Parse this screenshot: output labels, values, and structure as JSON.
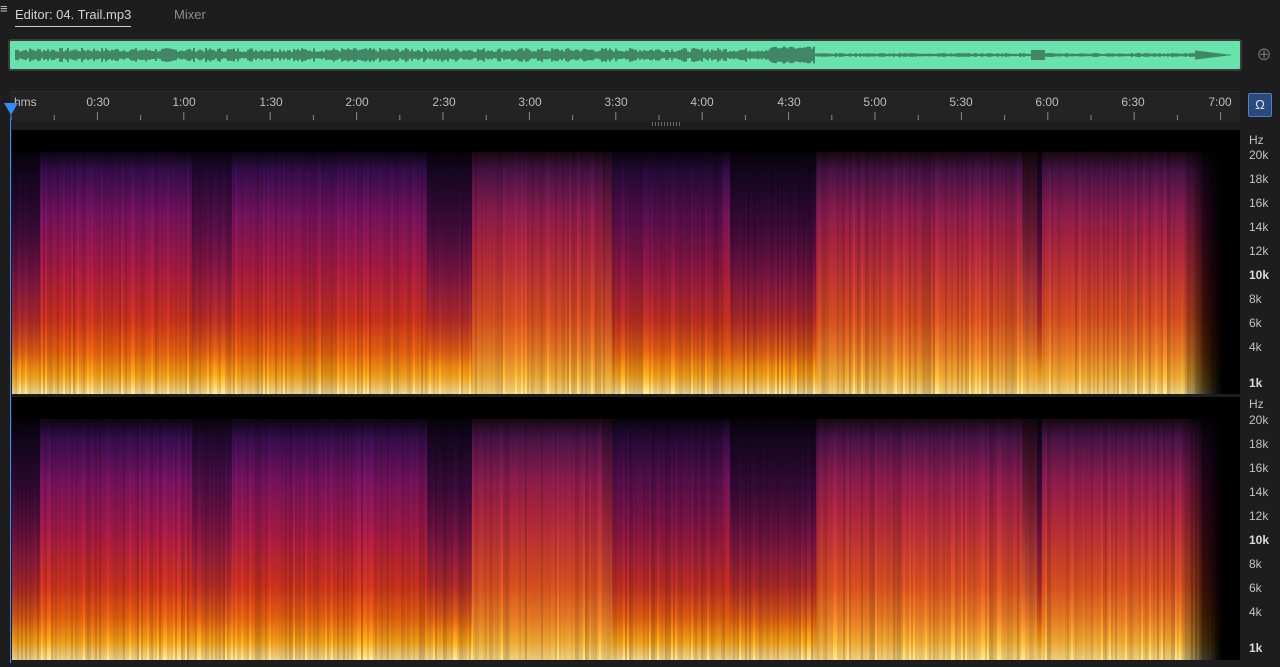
{
  "tabs": {
    "editor_label": "Editor: 04. Trail.mp3",
    "menu_icon": "≡",
    "mixer_label": "Mixer"
  },
  "overview": {
    "waveform_color": "#67e3ab",
    "zoom_icon": "zoom-navigator-icon"
  },
  "ruler": {
    "unit_label": "hms",
    "labels": [
      "0:30",
      "1:00",
      "1:30",
      "2:00",
      "2:30",
      "3:00",
      "3:30",
      "4:00",
      "4:30",
      "5:00",
      "5:30",
      "6:00",
      "6:30",
      "7:00"
    ]
  },
  "monitor_button_icon": "headphones-icon",
  "spectrogram": {
    "hz_unit": "Hz",
    "channel1_labels": [
      "20k",
      "18k",
      "16k",
      "14k",
      "12k",
      "10k",
      "8k",
      "6k",
      "4k",
      "1k"
    ],
    "channel2_labels": [
      "20k",
      "18k",
      "16k",
      "14k",
      "12k",
      "10k",
      "8k",
      "6k",
      "4k",
      "1k"
    ],
    "colors": {
      "accent": "#2f8cff",
      "low": "#fff0a0",
      "mid": "#d9381f",
      "high": "#3a0f55"
    }
  }
}
